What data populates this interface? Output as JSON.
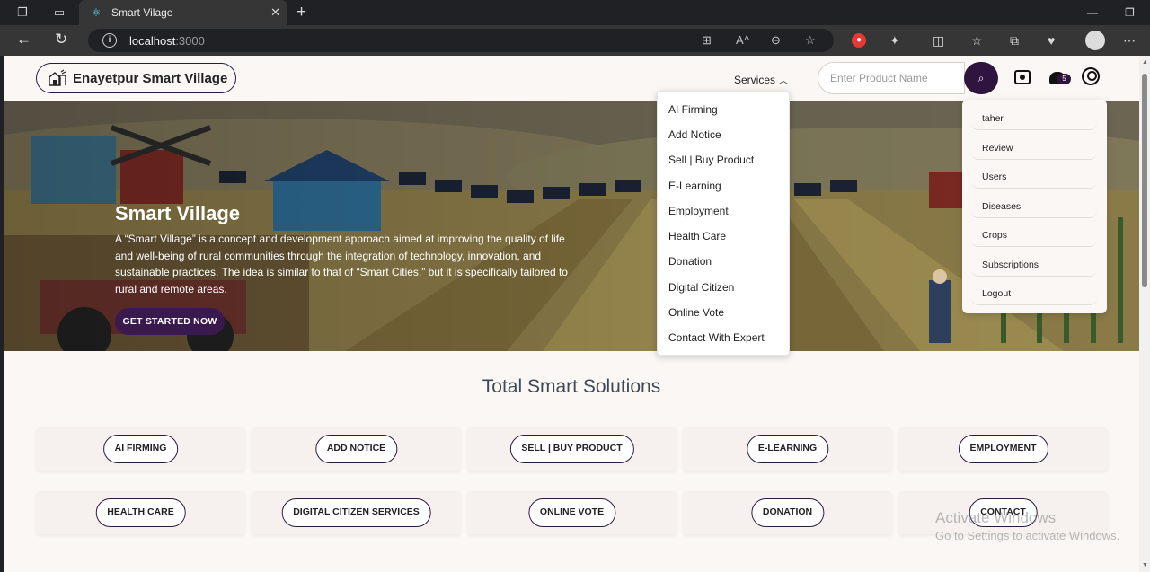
{
  "browser": {
    "tab_title": "Smart Vilage",
    "url_host": "localhost",
    "url_port": ":3000"
  },
  "navbar": {
    "logo_text": "Enayetpur Smart Village",
    "services_label": "Services",
    "search_placeholder": "Enter Product Name",
    "notification_count": "5"
  },
  "hero": {
    "title": "Smart Village",
    "text": "A “Smart Village” is a concept and development approach aimed at improving the quality of life and well-being of rural communities through the integration of technology, innovation, and sustainable practices. The idea is similar to that of “Smart Cities,” but it is specifically tailored to rural and remote areas.",
    "cta_label": "GET STARTED NOW"
  },
  "services_dropdown": [
    "AI Firming",
    "Add Notice",
    "Sell | Buy Product",
    "E-Learning",
    "Employment",
    "Health Care",
    "Donation",
    "Digital Citizen",
    "Online Vote",
    "Contact With Expert"
  ],
  "user_menu": [
    "taher",
    "Review",
    "Users",
    "Diseases",
    "Crops",
    "Subscriptions",
    "Logout"
  ],
  "solutions": {
    "title": "Total Smart Solutions",
    "cards": [
      "AI FIRMING",
      "ADD NOTICE",
      "SELL | BUY PRODUCT",
      "E-LEARNING",
      "EMPLOYMENT",
      "HEALTH CARE",
      "DIGITAL CITIZEN SERVICES",
      "ONLINE VOTE",
      "DONATION",
      "CONTACT"
    ]
  },
  "watermark": {
    "line1": "Activate Windows",
    "line2": "Go to Settings to activate Windows."
  },
  "colors": {
    "brand_dark": "#2f1440",
    "page_bg": "#fbf7f4",
    "browser_chrome": "#363636"
  }
}
